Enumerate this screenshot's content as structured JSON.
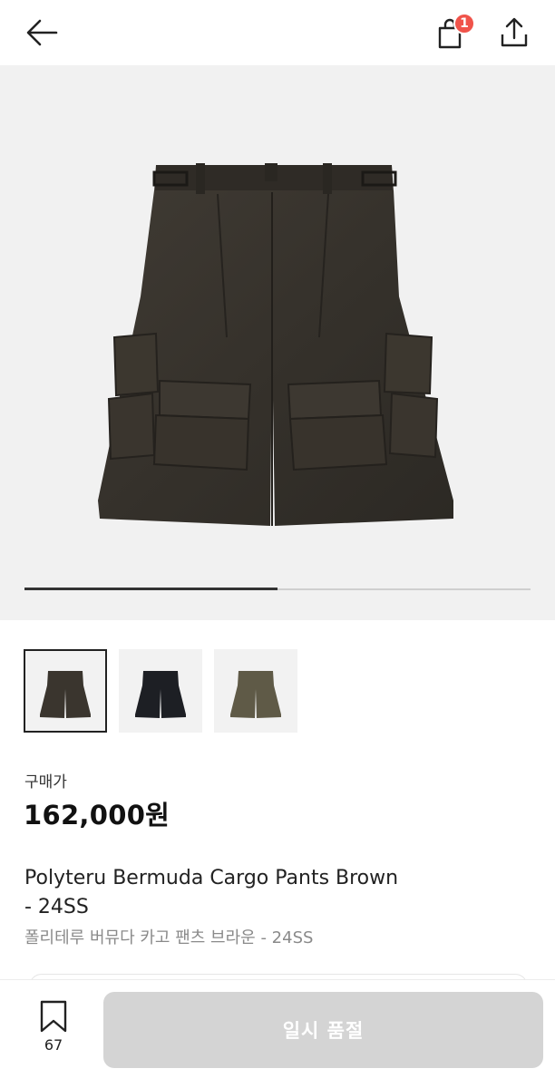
{
  "header": {
    "back_icon": "arrow-left-icon",
    "bag_icon": "shopping-bag-icon",
    "bag_badge": "1",
    "share_icon": "share-icon",
    "badge_color": "#f0534a"
  },
  "gallery": {
    "image_count": 2,
    "current_index": 1,
    "progress_fraction": 0.5
  },
  "thumbnails": [
    {
      "label": "Brown",
      "color": "#3a352e",
      "selected": true
    },
    {
      "label": "Black",
      "color": "#1d1f24",
      "selected": false
    },
    {
      "label": "Khaki",
      "color": "#5f5a47",
      "selected": false
    }
  ],
  "product": {
    "price_label": "구매가",
    "price": "162,000원",
    "title_en_line1": "Polyteru Bermuda Cargo Pants Brown",
    "title_en_line2": "- 24SS",
    "title_ko": "폴리테루 버뮤다 카고 팬츠 브라운 - 24SS"
  },
  "bottom": {
    "bookmark_icon": "bookmark-icon",
    "wish_count": "67",
    "cta_label": "일시 품절",
    "cta_color": "#d4d4d4"
  }
}
